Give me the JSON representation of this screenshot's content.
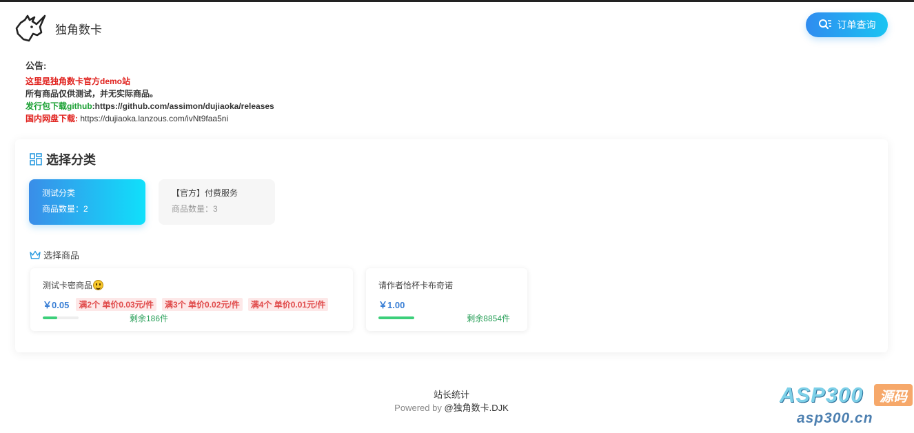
{
  "header": {
    "site_title": "独角数卡",
    "order_button_label": "订单查询"
  },
  "notice": {
    "title": "公告:",
    "line1": "这里是独角数卡官方demo站",
    "line2": "所有商品仅供测试，并无实际商品。",
    "line3_label": "发行包下载github",
    "line3_value": ":https://github.com/assimon/dujiaoka/releases",
    "line4_label": "国内网盘下载:",
    "line4_value": " https://dujiaoka.lanzous.com/ivNt9faa5ni"
  },
  "categories": {
    "heading": "选择分类",
    "items": [
      {
        "name": "测试分类",
        "count": "商品数量：2",
        "active": true
      },
      {
        "name": "【官方】付费服务",
        "count": "商品数量：3",
        "active": false
      }
    ]
  },
  "goods": {
    "heading": "选择商品",
    "items": [
      {
        "name": "测试卡密商品",
        "price": "￥0.05",
        "tags": [
          "满2个 单价0.03元/件",
          "满3个 单价0.02元/件",
          "满4个 单价0.01元/件"
        ],
        "stock": "剩余186件",
        "stock_fraction": 0.4
      },
      {
        "name": "请作者恰杯卡布奇诺",
        "price": "￥1.00",
        "tags": [],
        "stock": "剩余8854件",
        "stock_fraction": 1.0
      }
    ]
  },
  "footer": {
    "stats": "站长统计",
    "powered_prefix": "Powered by ",
    "powered_brand": "@独角数卡.DJK"
  },
  "watermark": {
    "brand": "ASP300",
    "tag": "源码",
    "url": "asp300.cn"
  },
  "colors": {
    "accent_start": "#2f8cf0",
    "accent_end": "#19c4f2",
    "notice_red": "#e0201c",
    "notice_green": "#1aa033",
    "price_blue": "#3a7fd5",
    "tag_red": "#e04a4a",
    "stock_green": "#2aa05a"
  }
}
